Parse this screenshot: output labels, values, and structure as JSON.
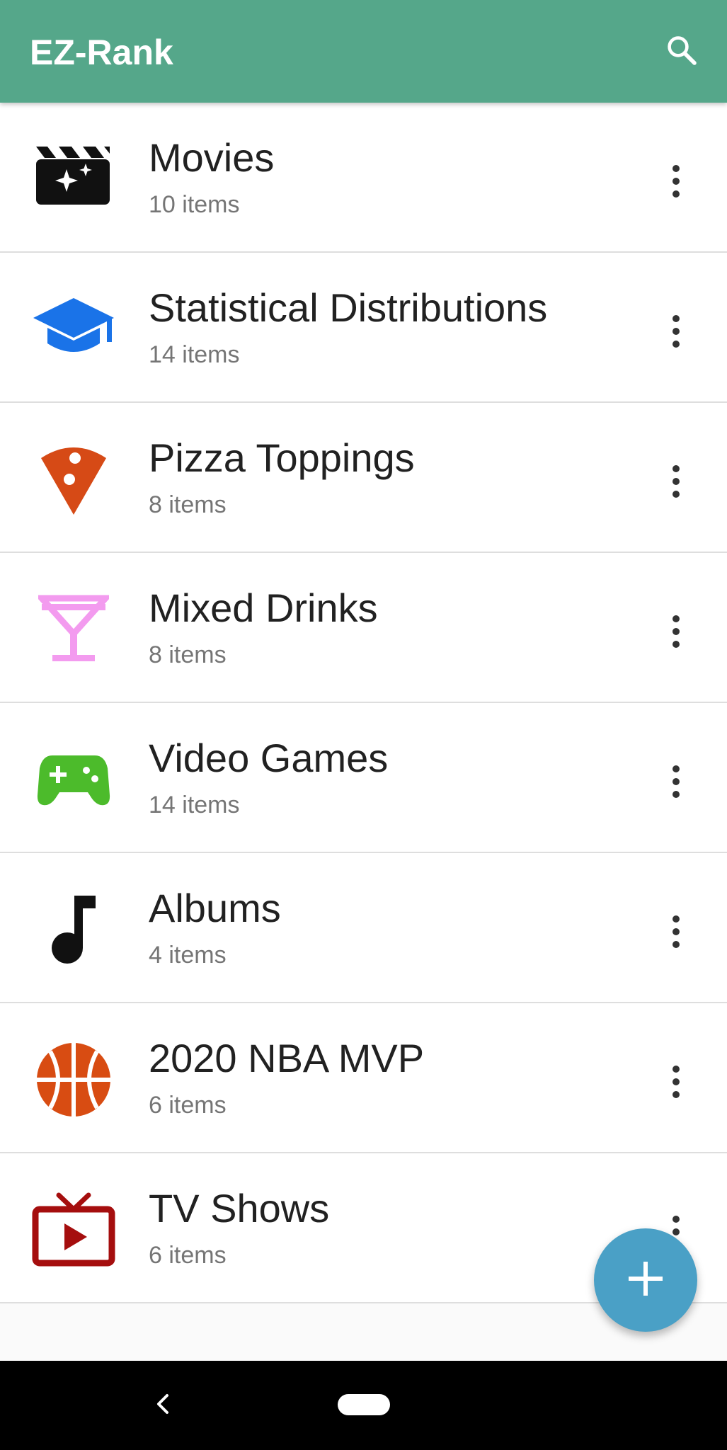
{
  "app": {
    "title": "EZ-Rank",
    "toolbar_color": "#55a78a",
    "search_icon": "search-icon"
  },
  "lists": [
    {
      "title": "Movies",
      "count": "10 items",
      "icon": "movie-clapperboard-icon",
      "icon_color": "#111111"
    },
    {
      "title": "Statistical Distributions",
      "count": "14 items",
      "icon": "graduation-cap-icon",
      "icon_color": "#1a73e8"
    },
    {
      "title": "Pizza Toppings",
      "count": "8 items",
      "icon": "pizza-slice-icon",
      "icon_color": "#d64a16"
    },
    {
      "title": "Mixed Drinks",
      "count": "8 items",
      "icon": "cocktail-glass-icon",
      "icon_color": "#f39bef"
    },
    {
      "title": "Video Games",
      "count": "14 items",
      "icon": "gamepad-icon",
      "icon_color": "#4cbb2b"
    },
    {
      "title": "Albums",
      "count": "4 items",
      "icon": "music-note-icon",
      "icon_color": "#111111"
    },
    {
      "title": "2020 NBA MVP",
      "count": "6 items",
      "icon": "basketball-icon",
      "icon_color": "#d84c12"
    },
    {
      "title": "TV Shows",
      "count": "6 items",
      "icon": "tv-play-icon",
      "icon_color": "#a50e0e"
    }
  ],
  "fab": {
    "icon": "plus-icon",
    "color": "#4aa0c6"
  },
  "system_nav": {
    "back_icon": "back-chevron-icon",
    "home_icon": "home-pill-icon"
  }
}
